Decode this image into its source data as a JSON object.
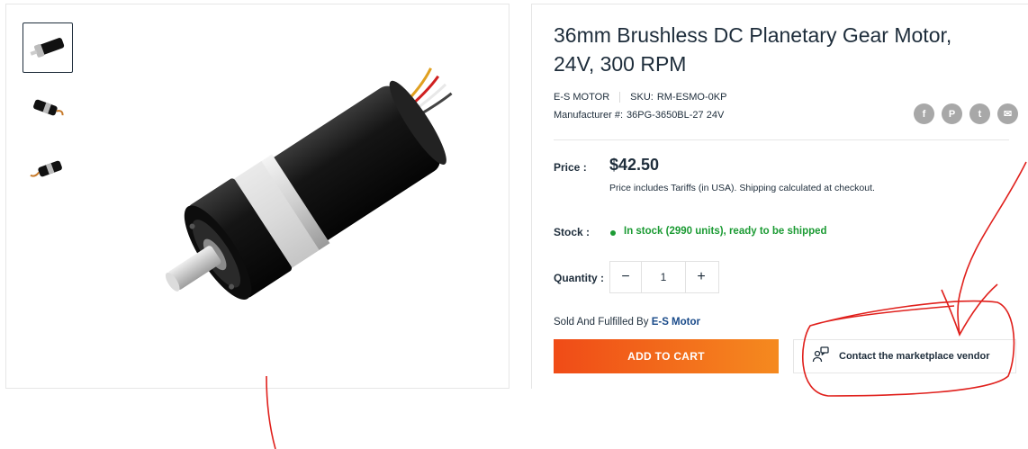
{
  "product": {
    "title": "36mm Brushless DC Planetary Gear Motor, 24V, 300 RPM",
    "vendor": "E-S MOTOR",
    "sku_label": "SKU:",
    "sku": "RM-ESMO-0KP",
    "manufacturer_label": "Manufacturer #:",
    "manufacturer_number": "36PG-3650BL-27 24V"
  },
  "share_icons": [
    "facebook-icon",
    "pinterest-icon",
    "twitter-icon",
    "email-icon"
  ],
  "share_glyphs": {
    "facebook": "f",
    "pinterest": "P",
    "twitter": "t",
    "email": "✉"
  },
  "price": {
    "label": "Price :",
    "value": "$42.50",
    "note": "Price includes Tariffs (in USA).  Shipping calculated at checkout."
  },
  "stock": {
    "label": "Stock :",
    "text": "In stock (2990 units), ready to be shipped",
    "color": "#1c9b34"
  },
  "quantity": {
    "label": "Quantity :",
    "value": "1",
    "minus": "−",
    "plus": "+"
  },
  "seller": {
    "prefix": "Sold And Fulfilled By",
    "name": "E-S Motor"
  },
  "buttons": {
    "add_to_cart": "ADD TO CART",
    "contact_vendor": "Contact the marketplace vendor"
  },
  "colors": {
    "accent_gradient_start": "#f04b17",
    "accent_gradient_end": "#f58a1f",
    "annotation": "#e0201c",
    "text": "#1e2d3b"
  },
  "gallery": {
    "thumbnail_count": 3,
    "active_index": 0
  }
}
